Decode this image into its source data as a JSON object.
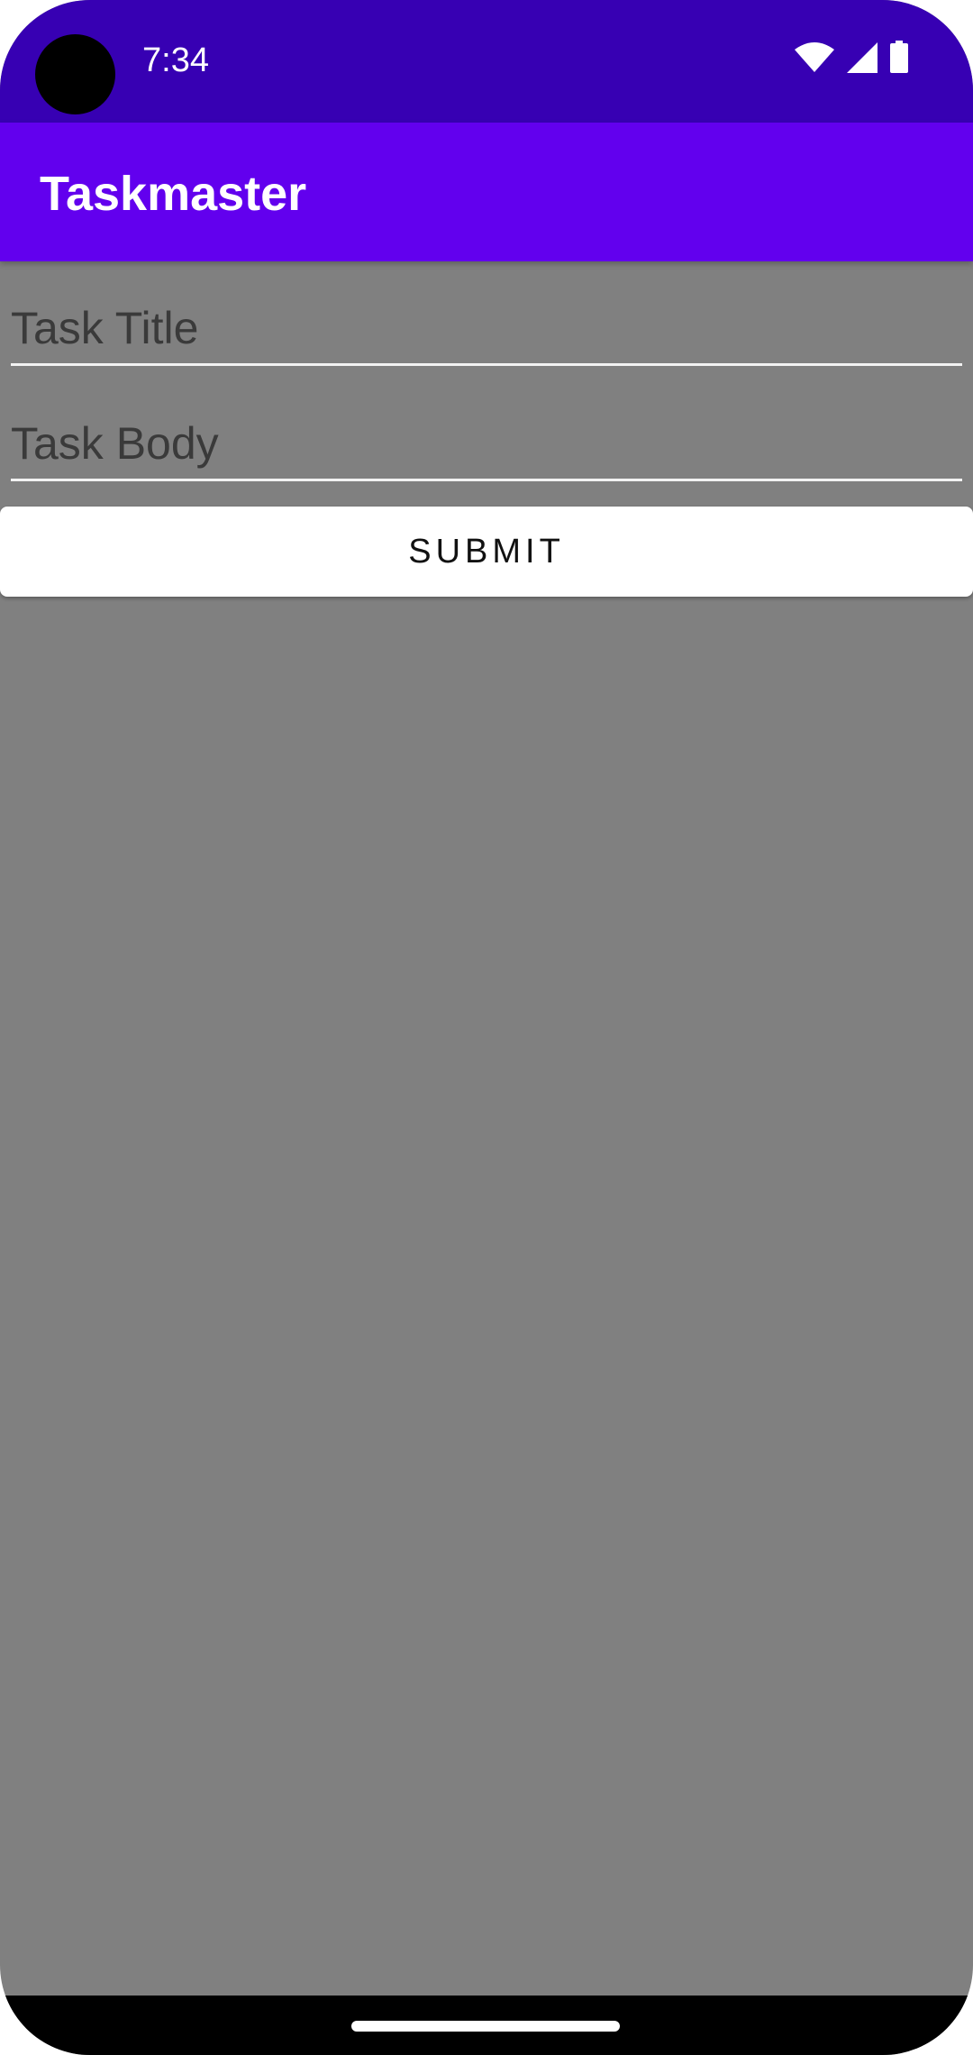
{
  "status_bar": {
    "time": "7:34",
    "icons": [
      "wifi-icon",
      "cellular-signal-icon",
      "battery-icon"
    ]
  },
  "app_bar": {
    "title": "Taskmaster"
  },
  "form": {
    "title_field": {
      "placeholder": "Task Title",
      "value": ""
    },
    "body_field": {
      "placeholder": "Task Body",
      "value": ""
    },
    "submit_label": "SUBMIT"
  },
  "colors": {
    "status_bar": "#3700b3",
    "app_bar": "#6200ee",
    "background": "#808080",
    "button": "#ffffff"
  }
}
